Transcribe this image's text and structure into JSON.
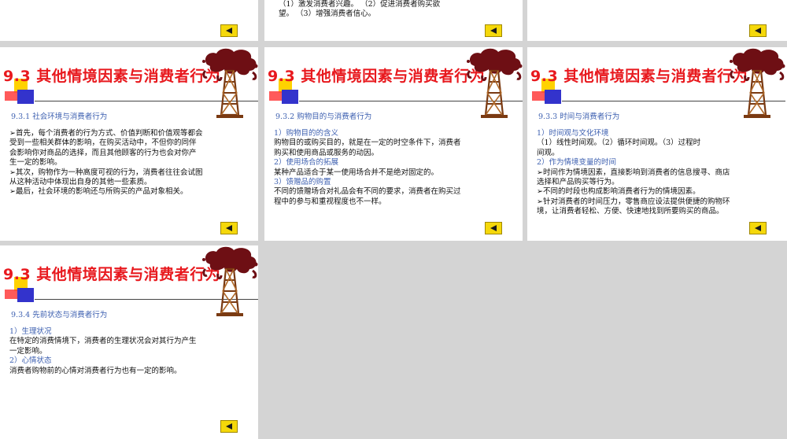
{
  "top_partial": {
    "line1": "（1）激发消费者兴趣。 （2）促进消费者购买欲",
    "line2": "望。 （3）增强消费者信心。"
  },
  "slides": [
    {
      "title": "9.3  其他情境因素与消费者行为",
      "subhead": "9.3.1 社会环境与消费者行为",
      "lines": [
        {
          "text": "➢首先，每个消费者的行为方式、价值判断和价值观等都会",
          "hl": false
        },
        {
          "text": "受到一些相关群体的影响，在购买活动中，不但你的同伴",
          "hl": false
        },
        {
          "text": "会影响你对商品的选择，而且其他顾客的行为也会对你产",
          "hl": false
        },
        {
          "text": "生一定的影响。",
          "hl": false
        },
        {
          "text": "➢其次，购物作为一种高度可视的行为，消费者往往会试图",
          "hl": false
        },
        {
          "text": "从这种活动中体现出自身的其他一些素质。",
          "hl": false
        },
        {
          "text": "➢最后，社会环境的影响还与所购买的产品对象相关。",
          "hl": false
        }
      ]
    },
    {
      "title": "9.3  其他情境因素与消费者行为",
      "subhead": "9.3.2 购物目的与消费者行为",
      "lines": [
        {
          "text": "1）购物目的的含义",
          "hl": true
        },
        {
          "text": "购物目的或购买目的，就是在一定的时空条件下，消费者",
          "hl": false
        },
        {
          "text": "购买和使用商品或服务的动因。",
          "hl": false
        },
        {
          "text": "2）使用场合的拓展",
          "hl": true
        },
        {
          "text": "某种产品适合于某一使用场合并不是绝对固定的。",
          "hl": false
        },
        {
          "text": "3）馈赠品的购置",
          "hl": true
        },
        {
          "text": "不同的馈赠场合对礼品会有不同的要求，消费者在购买过",
          "hl": false
        },
        {
          "text": "程中的参与和重视程度也不一样。",
          "hl": false
        }
      ]
    },
    {
      "title": "9.3  其他情境因素与消费者行为",
      "subhead": "9.3.3 时间与消费者行为",
      "lines": [
        {
          "text": "1）时间观与文化环境",
          "hl": true
        },
        {
          "text": "（1）线性时间观。（2）循环时间观。（3）过程时",
          "hl": false
        },
        {
          "text": "间观。",
          "hl": false
        },
        {
          "text": "2）作为情境变量的时间",
          "hl": true
        },
        {
          "text": "➢时间作为情境因素，直接影响到消费者的信息搜寻、商店",
          "hl": false
        },
        {
          "text": "选择和产品购买等行为。",
          "hl": false
        },
        {
          "text": "➢不同的时段也构成影响消费者行为的情境因素。",
          "hl": false
        },
        {
          "text": "➢针对消费者的时间压力，零售商应设法提供便捷的购物环",
          "hl": false
        },
        {
          "text": "境，让消费者轻松、方便、快速地找到所要购买的商品。",
          "hl": false
        }
      ]
    },
    {
      "title": "9.3  其他情境因素与消费者行为",
      "subhead": "9.3.4 先前状态与消费者行为",
      "lines": [
        {
          "text": "1）生理状况",
          "hl": true
        },
        {
          "text": "在特定的消费情境下，消费者的生理状况会对其行为产生",
          "hl": false
        },
        {
          "text": "一定影响。",
          "hl": false
        },
        {
          "text": "2）心情状态",
          "hl": true
        },
        {
          "text": "消费者购物前的心情对消费者行为也有一定的影响。",
          "hl": false
        }
      ]
    }
  ],
  "colors": {
    "title": "#e8191e",
    "subhead": "#3c5fb0",
    "nav_button": "#f5d80a",
    "background": "#d4d4d4"
  },
  "icons": {
    "nav": "back-arrow-icon",
    "logo": "oil-tower-icon"
  }
}
